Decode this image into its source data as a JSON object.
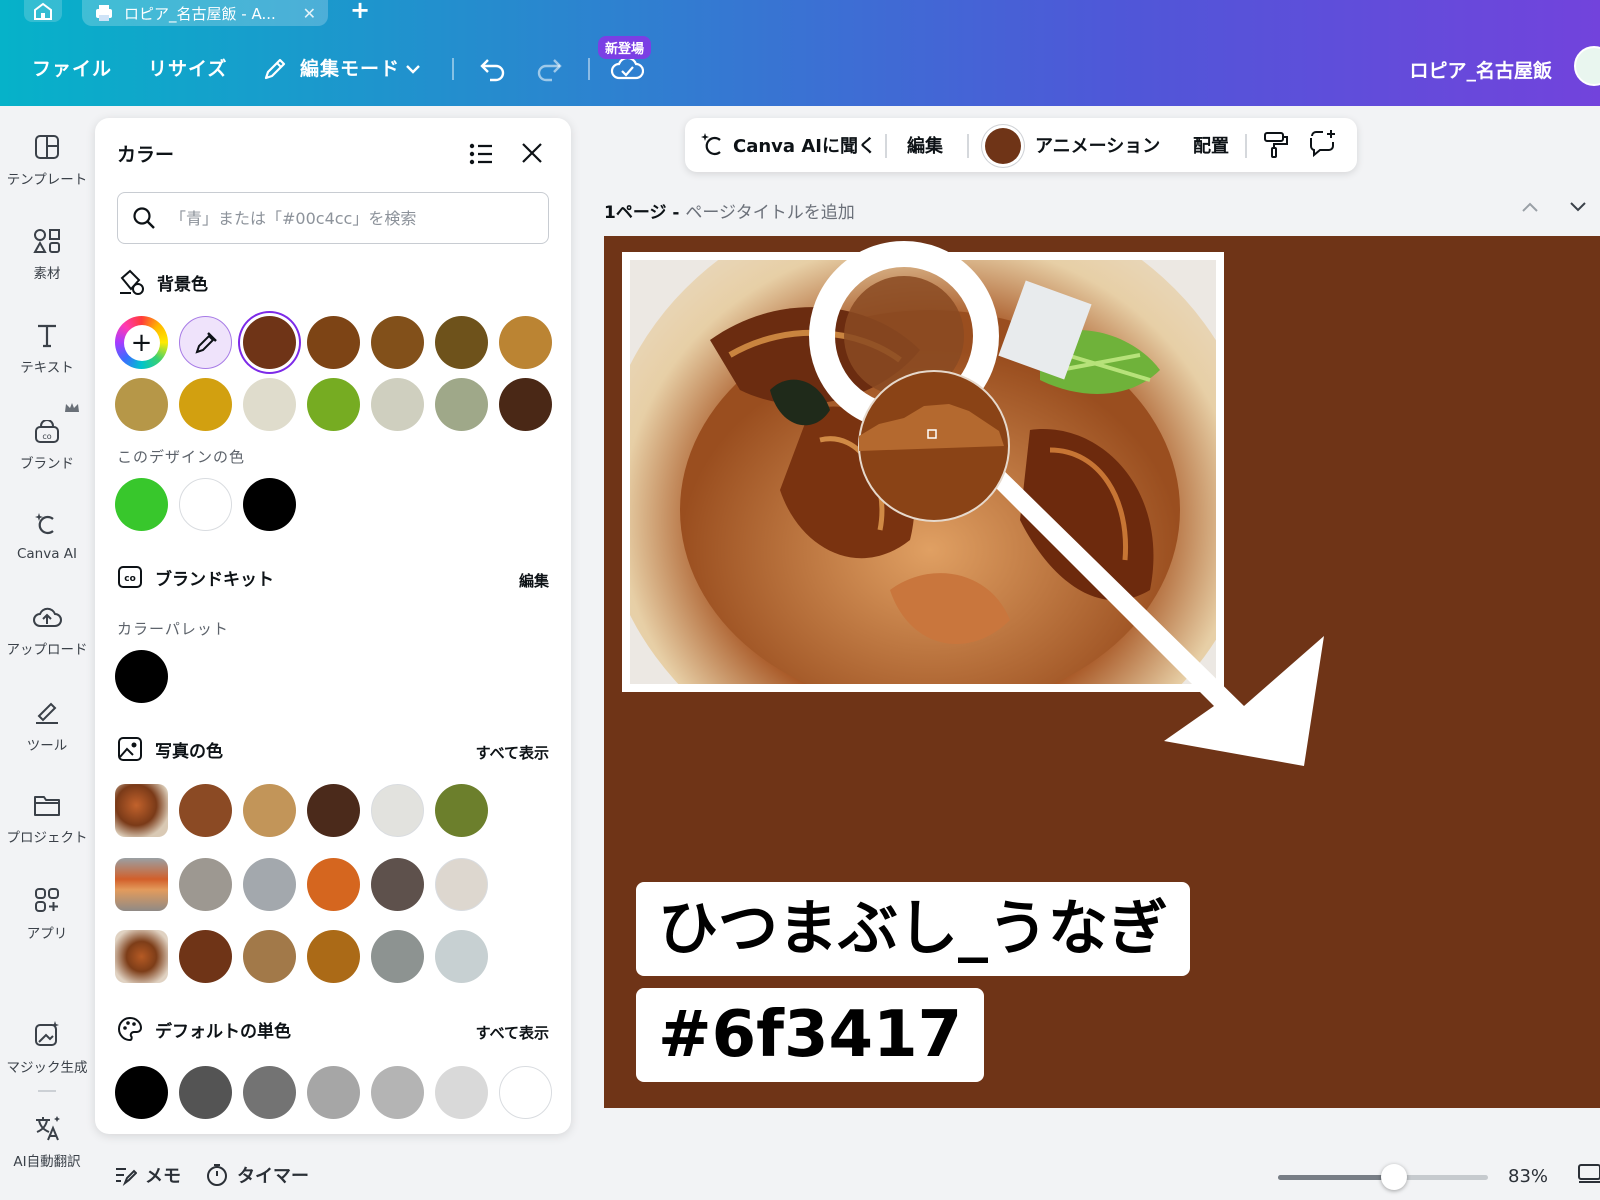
{
  "tabs": {
    "doc_title": "ロピア_名古屋飯 - A..."
  },
  "menu": {
    "file": "ファイル",
    "resize": "リサイズ",
    "edit_mode": "編集モード",
    "new_badge": "新登場",
    "project_name": "ロピア_名古屋飯"
  },
  "rail": {
    "items": [
      {
        "label": "テンプレート",
        "icon": "template-icon"
      },
      {
        "label": "素材",
        "icon": "elements-icon"
      },
      {
        "label": "テキスト",
        "icon": "text-icon"
      },
      {
        "label": "ブランド",
        "icon": "brand-icon"
      },
      {
        "label": "Canva AI",
        "icon": "canva-ai-icon"
      },
      {
        "label": "アップロード",
        "icon": "upload-icon"
      },
      {
        "label": "ツール",
        "icon": "tools-icon"
      },
      {
        "label": "プロジェクト",
        "icon": "project-icon"
      },
      {
        "label": "アプリ",
        "icon": "apps-icon"
      },
      {
        "label": "マジック生成",
        "icon": "magic-icon"
      },
      {
        "label": "AI自動翻訳",
        "icon": "translate-icon"
      }
    ]
  },
  "panel": {
    "title": "カラー",
    "search_placeholder": "「青」または「#00c4cc」を検索",
    "background_title": "背景色",
    "background_colors": [
      "#6f3417",
      "#7d4415",
      "#82501a",
      "#6e521b",
      "#bb8433",
      "#b69748",
      "#d2a010",
      "#dfdccc",
      "#76ac22",
      "#cfcfbf",
      "#9fa889",
      "#4a2816"
    ],
    "design_colors_label": "このデザインの色",
    "design_colors": [
      "#38c72c",
      "#ffffff",
      "#000000"
    ],
    "brand_kit_title": "ブランドキット",
    "brand_kit_edit": "編集",
    "palette_label": "カラーパレット",
    "palette_colors": [
      "#000000"
    ],
    "photo_colors_title": "写真の色",
    "photo_colors_link": "すべて表示",
    "photo_rows": [
      [
        "#8b4a24",
        "#c29559",
        "#4b2a1b",
        "#e2e2de",
        "#6c7f2c"
      ],
      [
        "#9d9891",
        "#a3a8ad",
        "#d5661f",
        "#5e514c",
        "#ddd7cf"
      ],
      [
        "#6f3417",
        "#a27949",
        "#ab6a17",
        "#8d9391",
        "#c7d0d2"
      ]
    ],
    "default_title": "デフォルトの単色",
    "default_link": "すべて表示",
    "default_colors": [
      "#000000",
      "#545454",
      "#737373",
      "#a6a6a6",
      "#b4b4b4",
      "#d9d9d9",
      "#ffffff"
    ]
  },
  "floatbar": {
    "ask_ai": "Canva AIに聞く",
    "edit": "編集",
    "animation": "アニメーション",
    "arrange": "配置",
    "current_color": "#6f3417"
  },
  "page": {
    "label": "1ページ - ",
    "add_title": "ページタイトルを追加"
  },
  "canvas": {
    "background": "#6f3417",
    "title": "ひつまぶし_うなぎ",
    "code": "#6f3417"
  },
  "bottom": {
    "memo": "メモ",
    "timer": "タイマー",
    "zoom_label": "83%",
    "zoom_level": 0.55
  }
}
